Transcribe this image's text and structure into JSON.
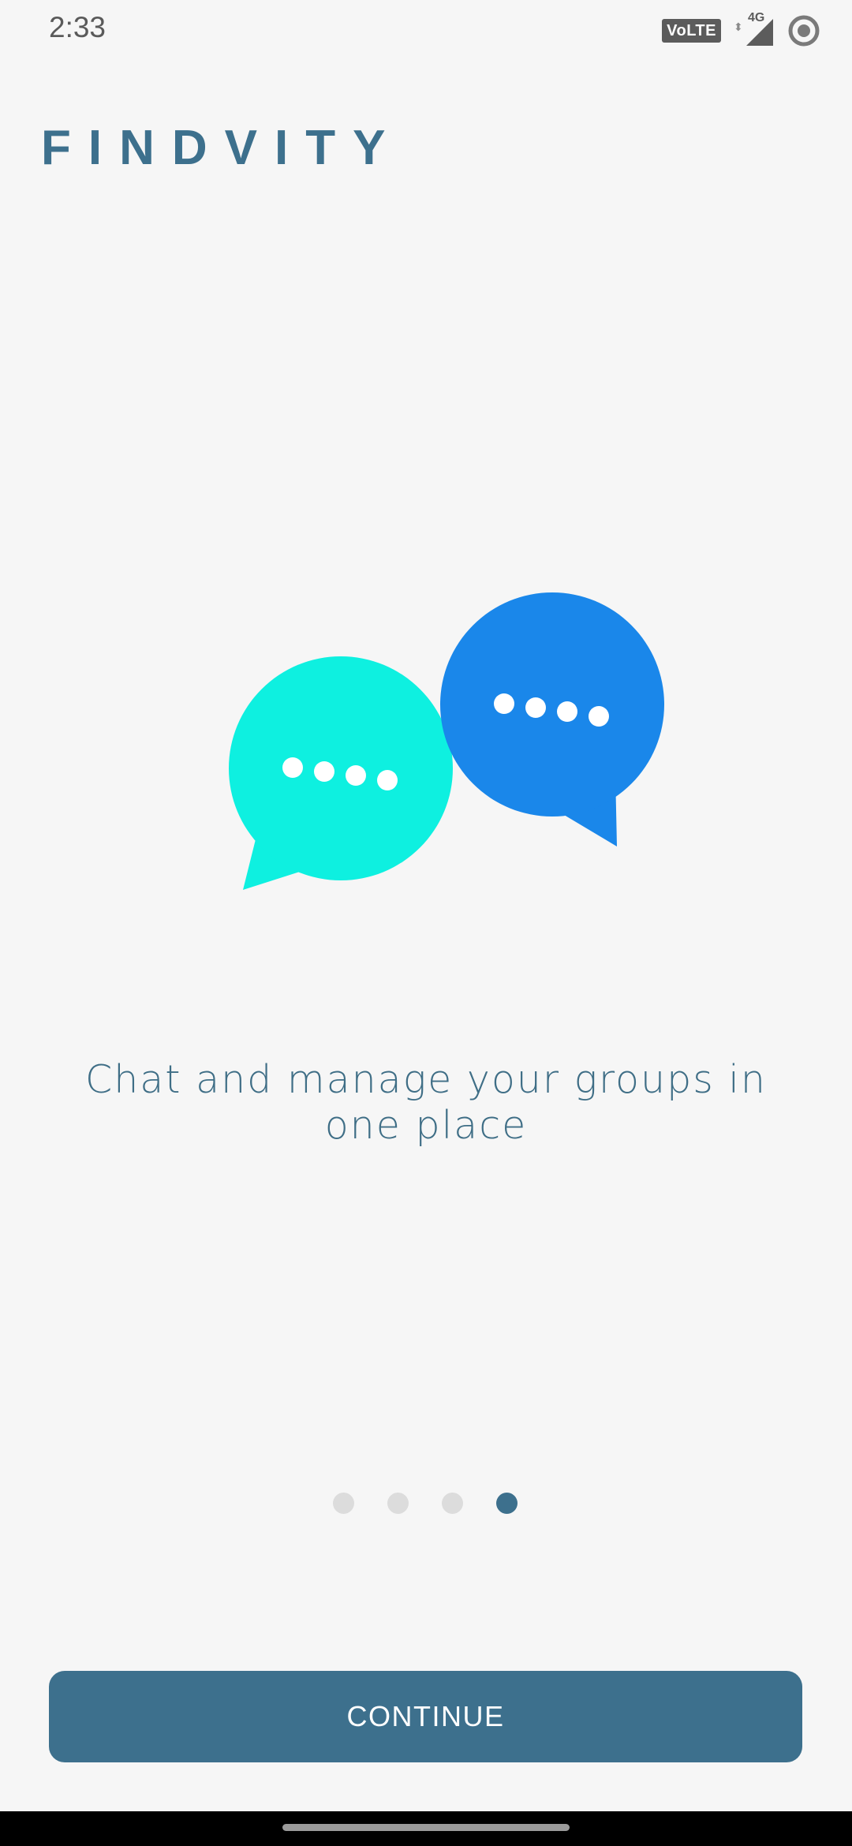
{
  "status_bar": {
    "time": "2:33",
    "volte": "VoLTE",
    "network": "4G"
  },
  "app": {
    "logo": "FINDVITY"
  },
  "onboarding": {
    "tagline": "Chat and manage your groups in one place",
    "pages_total": 4,
    "active_page": 4
  },
  "actions": {
    "continue_label": "CONTINUE"
  },
  "colors": {
    "brand": "#3d708d",
    "bubble_left": "#0ef0e0",
    "bubble_right": "#1a87ea",
    "background": "#f6f6f6"
  },
  "icons": {
    "illustration": "chat-bubbles-icon",
    "signal": "signal-icon",
    "status_circle": "ring-icon"
  }
}
